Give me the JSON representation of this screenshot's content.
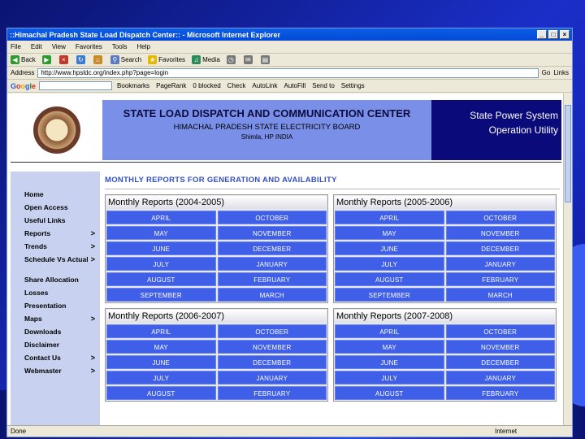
{
  "window": {
    "title": "::Himachal Pradesh State Load Dispatch Center:: - Microsoft Internet Explorer",
    "controls": [
      "_",
      "□",
      "×"
    ]
  },
  "menubar": [
    "File",
    "Edit",
    "View",
    "Favorites",
    "Tools",
    "Help"
  ],
  "toolbar": [
    "Back",
    "Search",
    "Favorites",
    "Media"
  ],
  "addressbar": {
    "label": "Address",
    "url": "http://www.hpsldc.org/index.php?page=login",
    "go": "Go",
    "links": "Links"
  },
  "googlebar": {
    "logo": [
      "G",
      "o",
      "o",
      "g",
      "l",
      "e"
    ],
    "items": [
      "Bookmarks",
      "PageRank",
      "0 blocked",
      "Check",
      "AutoLink",
      "AutoFill",
      "Send to",
      "Settings"
    ]
  },
  "header": {
    "title": "STATE LOAD DISPATCH AND COMMUNICATION CENTER",
    "subtitle": "HIMACHAL PRADESH STATE ELECTRICITY BOARD",
    "location": "Shimla, HP INDIA",
    "right_line1": "State Power System",
    "right_line2": "Operation Utility"
  },
  "sidebar": [
    {
      "label": "Home",
      "arrow": ""
    },
    {
      "label": "Open Access",
      "arrow": ""
    },
    {
      "label": "Useful Links",
      "arrow": ""
    },
    {
      "label": "Reports",
      "arrow": ">"
    },
    {
      "label": "Trends",
      "arrow": ">"
    },
    {
      "label": "Schedule Vs Actual",
      "arrow": ">"
    },
    {
      "label": "Share Allocation",
      "arrow": ""
    },
    {
      "label": "Losses",
      "arrow": ""
    },
    {
      "label": "Presentation",
      "arrow": ""
    },
    {
      "label": "Maps",
      "arrow": ">"
    },
    {
      "label": "Downloads",
      "arrow": ""
    },
    {
      "label": "Disclaimer",
      "arrow": ""
    },
    {
      "label": "Contact Us",
      "arrow": ">"
    },
    {
      "label": "Webmaster",
      "arrow": ">"
    }
  ],
  "main": {
    "title": "MONTHLY REPORTS FOR GENERATION AND AVAILABILITY",
    "tables": [
      {
        "heading": "Monthly Reports (2004-2005)",
        "months": [
          "APRIL",
          "OCTOBER",
          "MAY",
          "NOVEMBER",
          "JUNE",
          "DECEMBER",
          "JULY",
          "JANUARY",
          "AUGUST",
          "FEBRUARY",
          "SEPTEMBER",
          "MARCH"
        ]
      },
      {
        "heading": "Monthly Reports (2005-2006)",
        "months": [
          "APRIL",
          "OCTOBER",
          "MAY",
          "NOVEMBER",
          "JUNE",
          "DECEMBER",
          "JULY",
          "JANUARY",
          "AUGUST",
          "FEBRUARY",
          "SEPTEMBER",
          "MARCH"
        ]
      },
      {
        "heading": "Monthly Reports (2006-2007)",
        "months": [
          "APRIL",
          "OCTOBER",
          "MAY",
          "NOVEMBER",
          "JUNE",
          "DECEMBER",
          "JULY",
          "JANUARY",
          "AUGUST",
          "FEBRUARY"
        ]
      },
      {
        "heading": "Monthly Reports (2007-2008)",
        "months": [
          "APRIL",
          "OCTOBER",
          "MAY",
          "NOVEMBER",
          "JUNE",
          "DECEMBER",
          "JULY",
          "JANUARY",
          "AUGUST",
          "FEBRUARY"
        ]
      }
    ]
  },
  "status": {
    "left": "Done",
    "zone": "Internet"
  }
}
